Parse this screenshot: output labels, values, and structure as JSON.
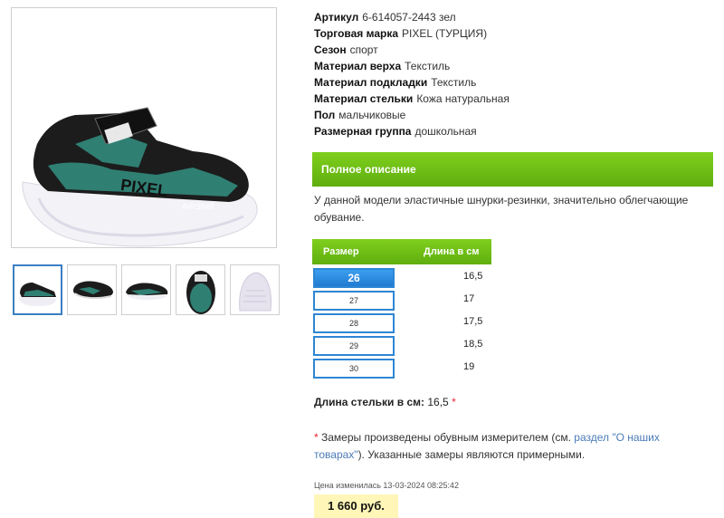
{
  "images": {
    "main_alt": "Кроссовки PIXEL",
    "shoe_brand_text": "PIXEL",
    "shoe_sole_text": "AIRShell",
    "thumbnails": [
      {
        "name": "thumb-1"
      },
      {
        "name": "thumb-2"
      },
      {
        "name": "thumb-3"
      },
      {
        "name": "thumb-4"
      },
      {
        "name": "thumb-5"
      }
    ]
  },
  "specs": [
    {
      "key": "Артикул",
      "value": "6-614057-2443 зел"
    },
    {
      "key": "Торговая марка",
      "value": "PIXEL (ТУРЦИЯ)"
    },
    {
      "key": "Сезон",
      "value": "спорт"
    },
    {
      "key": "Материал верха",
      "value": "Текстиль"
    },
    {
      "key": "Материал подкладки",
      "value": "Текстиль"
    },
    {
      "key": "Материал стельки",
      "value": "Кожа натуральная"
    },
    {
      "key": "Пол",
      "value": "мальчиковые"
    },
    {
      "key": "Размерная группа",
      "value": "дошкольная"
    }
  ],
  "description": {
    "header": "Полное описание",
    "text": "У данной модели эластичные шнурки-резинки, значительно облегчающие обувание."
  },
  "size_table": {
    "col_size": "Размер",
    "col_length": "Длина в см",
    "rows": [
      {
        "size": "26",
        "length": "16,5",
        "active": true
      },
      {
        "size": "27",
        "length": "17",
        "active": false
      },
      {
        "size": "28",
        "length": "17,5",
        "active": false
      },
      {
        "size": "29",
        "length": "18,5",
        "active": false
      },
      {
        "size": "30",
        "length": "19",
        "active": false
      }
    ]
  },
  "insole": {
    "label": "Длина стельки в см:",
    "value": "16,5",
    "mark": "*"
  },
  "note": {
    "star": "*",
    "text_before": " Замеры произведены обувным измерителем (см. ",
    "link": "раздел \"О наших товарах\"",
    "text_after": "). Указанные замеры являются примерными."
  },
  "price": {
    "changed": "Цена изменилась 13-03-2024 08:25:42",
    "value": "1 660 руб."
  },
  "colors": {
    "accent_green": "#6cbf14",
    "size_blue": "#2e86d4",
    "price_bg": "#fff6b8",
    "shoe_teal": "#2f7f73"
  }
}
